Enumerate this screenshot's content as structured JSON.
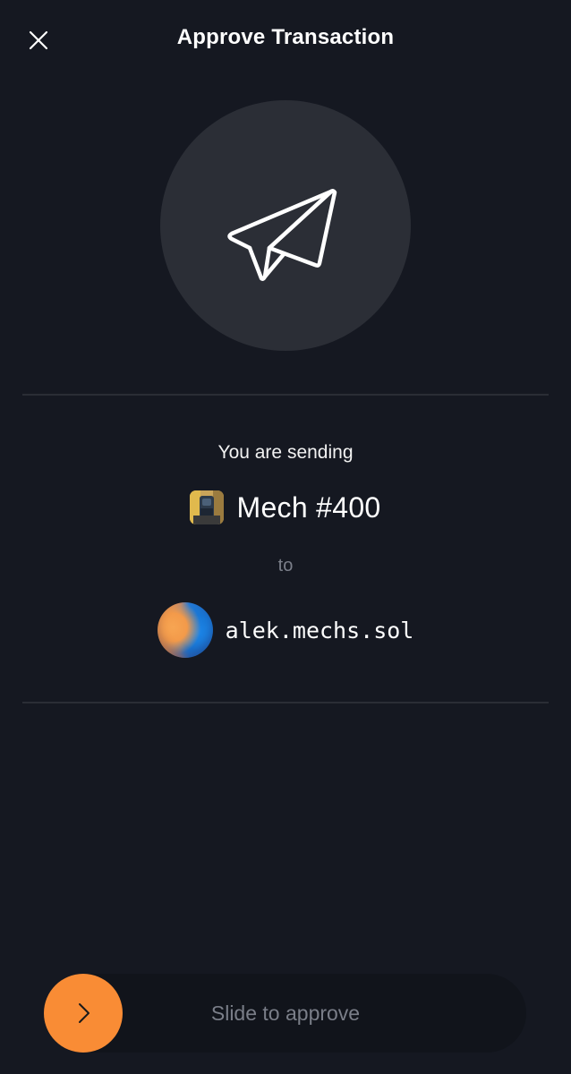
{
  "header": {
    "title": "Approve Transaction",
    "close_icon": "close-icon"
  },
  "hero": {
    "icon": "paper-plane-icon"
  },
  "transaction": {
    "sending_label": "You are sending",
    "asset_name": "Mech #400",
    "asset_thumb": "nft-thumbnail",
    "to_label": "to",
    "recipient": "alek.mechs.sol"
  },
  "slider": {
    "label": "Slide to approve",
    "knob_icon": "chevron-right-icon",
    "accent": "#f98c35"
  },
  "colors": {
    "background": "#151821",
    "hero_circle": "#2b2e36",
    "divider": "#2a2d35",
    "muted_text": "#7b7f8a"
  }
}
